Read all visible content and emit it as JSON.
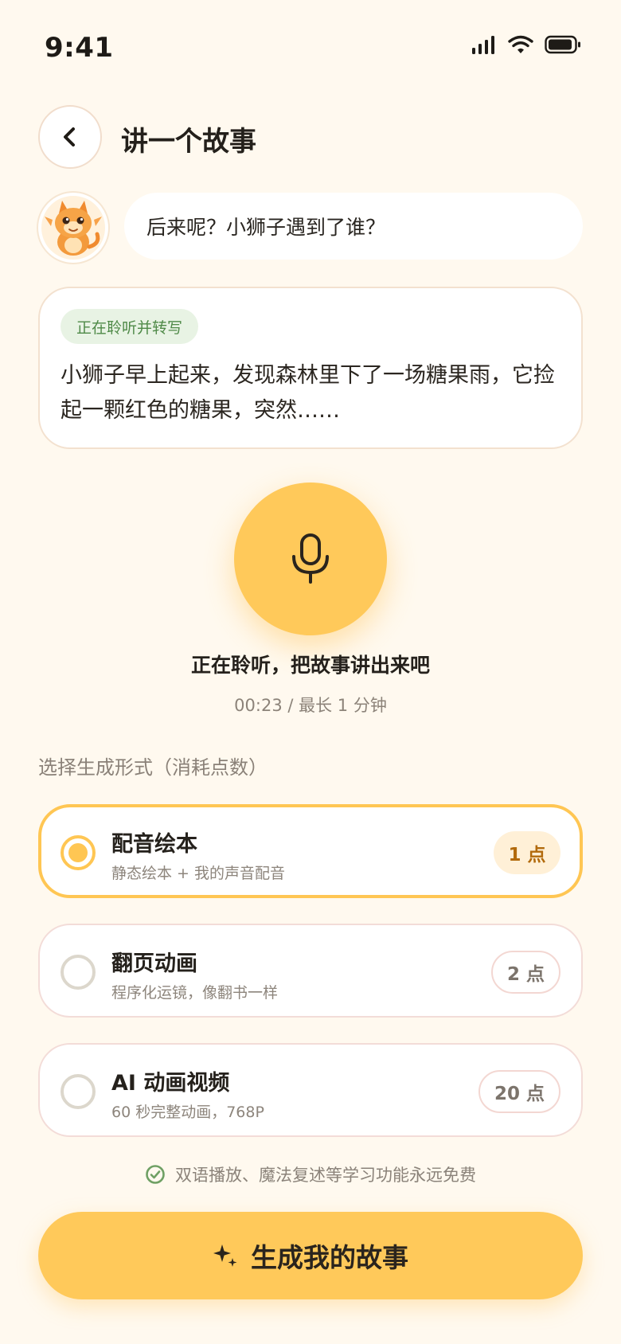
{
  "status_bar": {
    "time": "9:41"
  },
  "header": {
    "title": "讲一个故事"
  },
  "prompt_bubble": {
    "text": "后来呢？小狮子遇到了谁？"
  },
  "transcript": {
    "tag": "正在聆听并转写",
    "text": "小狮子早上起来，发现森林里下了一场糖果雨，它捡起一颗红色的糖果，突然……"
  },
  "recorder": {
    "title": "正在聆听，把故事讲出来吧",
    "timer": "00:23 / 最长 1 分钟"
  },
  "options_section": {
    "label": "选择生成形式（消耗点数）",
    "options": [
      {
        "title": "配音绘本",
        "subtitle": "静态绘本 + 我的声音配音",
        "cost": "1 点",
        "selected": true
      },
      {
        "title": "翻页动画",
        "subtitle": "程序化运镜，像翻书一样",
        "cost": "2 点",
        "selected": false
      },
      {
        "title": "AI 动画视频",
        "subtitle": "60 秒完整动画，768P",
        "cost": "20 点",
        "selected": false
      }
    ]
  },
  "free_note": "双语播放、魔法复述等学习功能永远免费",
  "cta": {
    "label": "生成我的故事"
  },
  "colors": {
    "background": "#FFF9EF",
    "accent": "#FFC95A",
    "accent_border": "#FFC653",
    "success_green": "#6FA064",
    "cost_selected_text": "#B26A0C"
  },
  "icons": [
    "signal-icon",
    "wifi-icon",
    "battery-icon",
    "back-chevron-icon",
    "dragon-avatar",
    "microphone-icon",
    "check-circle-icon",
    "sparkle-icon"
  ]
}
